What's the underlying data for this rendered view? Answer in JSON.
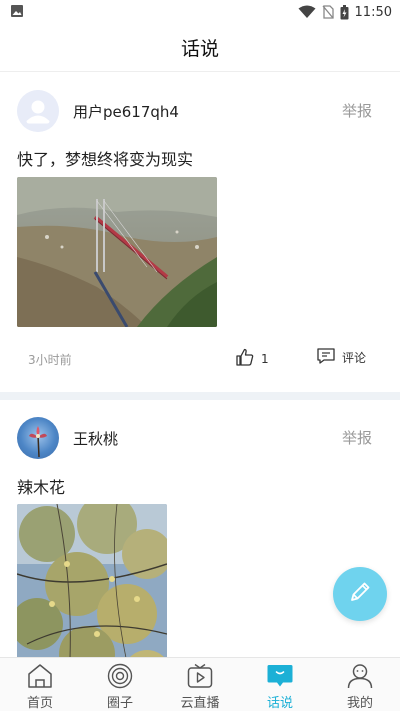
{
  "status_bar": {
    "time": "11:50",
    "icons": [
      "image-notification-icon",
      "wifi-icon",
      "no-sim-icon",
      "battery-charging-icon"
    ]
  },
  "header": {
    "title": "话说"
  },
  "posts": [
    {
      "username": "用户pe617qh4",
      "report_label": "举报",
      "text": "快了，梦想终将变为现实",
      "image_description": "bridge-over-valley-photo",
      "timestamp": "3小时前",
      "like_count": "1",
      "comment_label": "评论"
    },
    {
      "username": "王秋桃",
      "report_label": "举报",
      "text": "辣木花",
      "image_description": "tree-branches-photo"
    }
  ],
  "fab": {
    "icon": "pencil-icon"
  },
  "bottom_nav": {
    "items": [
      {
        "label": "首页",
        "icon": "home-icon"
      },
      {
        "label": "圈子",
        "icon": "circle-target-icon"
      },
      {
        "label": "云直播",
        "icon": "tv-play-icon"
      },
      {
        "label": "话说",
        "icon": "chat-bubble-icon",
        "active": true
      },
      {
        "label": "我的",
        "icon": "user-icon"
      }
    ]
  },
  "colors": {
    "accent": "#1cb0d6",
    "fab": "#6fd3ee",
    "muted_text": "#9a9a9a",
    "divider": "#eef2f6"
  }
}
